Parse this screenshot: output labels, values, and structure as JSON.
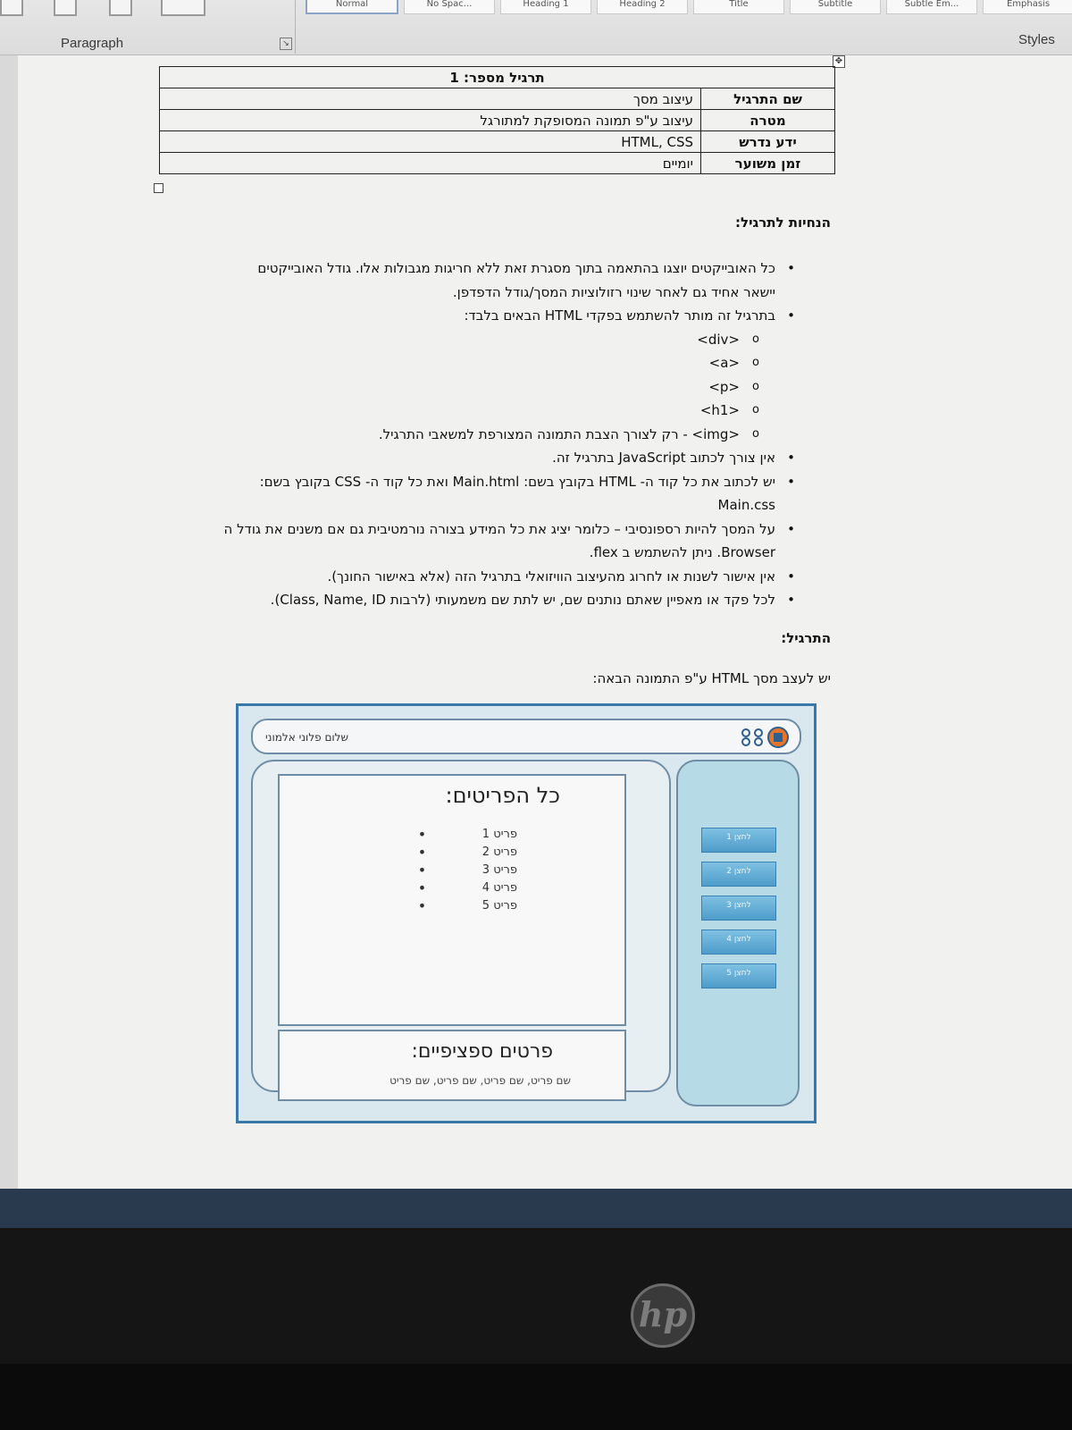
{
  "ribbon": {
    "styles_gallery": [
      "Normal",
      "No Spac...",
      "Heading 1",
      "Heading 2",
      "Title",
      "Subtitle",
      "Subtle Em...",
      "Emphasis"
    ],
    "paragraph_label": "Paragraph",
    "styles_label": "Styles"
  },
  "document": {
    "table": {
      "title": "תרגיל מספר: 1",
      "rows": [
        {
          "key": "שם התרגיל",
          "value": "עיצוב מסך"
        },
        {
          "key": "מטרה",
          "value": "עיצוב ע\"פ תמונה המסופקת למתורגל"
        },
        {
          "key": "ידע נדרש",
          "value": "HTML, CSS"
        },
        {
          "key": "זמן משוער",
          "value": "יומיים"
        }
      ]
    },
    "instructions_heading": "הנחיות לתרגיל:",
    "bullets": {
      "b1": "כל האובייקטים יוצגו בהתאמה בתוך מסגרת זאת ללא חריגות מגבולות אלו. גודל האובייקטים יישאר אחיד גם לאחר שינוי רזולוציות המסך/גודל הדפדפן.",
      "b2": "בתרגיל זה מותר להשתמש בפקדי HTML הבאים בלבד:",
      "tag1": "<div>",
      "tag2": "<a>",
      "tag3": "<p>",
      "tag4": "<h1>",
      "tag5": "<img> - רק לצורך הצבת התמונה המצורפת למשאבי התרגיל.",
      "b3": "אין צורך לכתוב JavaScript בתרגיל זה.",
      "b4": "יש לכתוב את כל קוד ה- HTML בקובץ בשם: Main.html ואת כל קוד ה- CSS בקובץ בשם: Main.css",
      "b5": "על המסך להיות רספונסיבי – כלומר יציג את כל המידע בצורה נורמטיבית גם אם משנים את גודל ה Browser. ניתן להשתמש ב flex.",
      "b6": "אין אישור לשנות או לחרוג מהעיצוב הוויזואלי בתרגיל הזה (אלא באישור החונך).",
      "b7": "לכל פקד או מאפיין שאתם נותנים שם, יש לתת שם משמעותי (לרבות Class, Name, ID)."
    },
    "exercise_heading": "התרגיל:",
    "exercise_text": "יש לעצב מסך HTML ע\"פ התמונה הבאה:"
  },
  "mockup": {
    "greeting": "שלום פלוני אלמוני",
    "list_title": "כל הפריטים:",
    "items": [
      "פריט 1",
      "פריט 2",
      "פריט 3",
      "פריט 4",
      "פריט 5"
    ],
    "details_title": "פרטים ספציפיים:",
    "details_text": "שם פריט, שם פריט, שם פריט, שם פריט",
    "menu_buttons": [
      "לחצן 1",
      "לחצן 2",
      "לחצן 3",
      "לחצן 4",
      "לחצן 5"
    ]
  },
  "monitor": {
    "brand": "hp"
  },
  "colors": {
    "mockup_border": "#3a78a8",
    "sidebar": "#b6dbe6",
    "button": "#5aa6d3",
    "page": "#f1f1f0"
  }
}
